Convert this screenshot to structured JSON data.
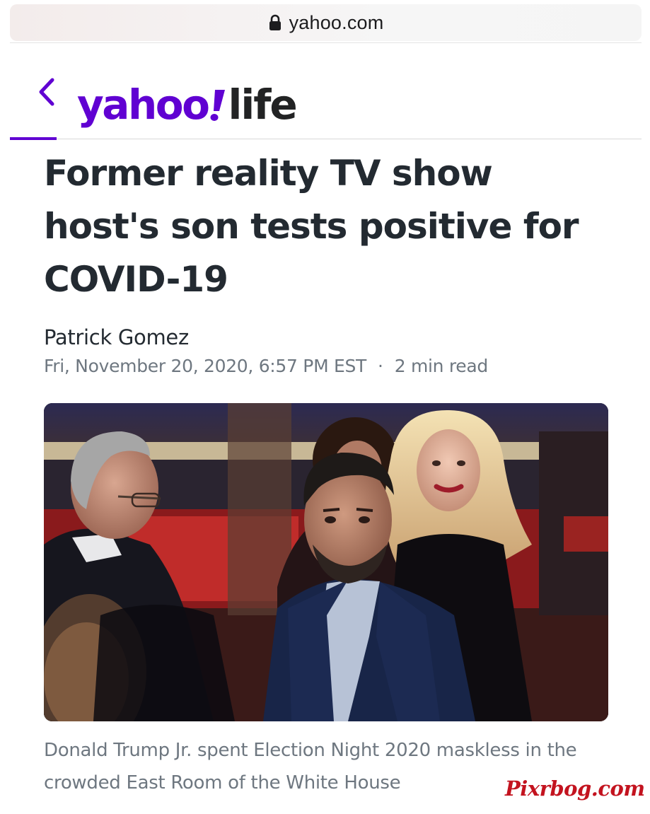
{
  "browser": {
    "url": "yahoo.com",
    "lock_icon": "lock-icon"
  },
  "header": {
    "back_icon": "chevron-left-icon",
    "logo_text_primary": "yahoo",
    "logo_text_bang": "!",
    "logo_text_secondary": "life",
    "brand_color": "#6001d2"
  },
  "article": {
    "headline": "Former reality TV show host's son tests positive for COVID-19",
    "author": "Patrick Gomez",
    "date": "Fri, November 20, 2020, 6:57 PM EST",
    "separator": "·",
    "read_time": "2 min read",
    "caption": "Donald Trump Jr. spent Election Night 2020 maskless in the crowded East Room of the White House"
  },
  "watermark": {
    "text": "Pixrbog.com",
    "color": "#c3131f"
  }
}
